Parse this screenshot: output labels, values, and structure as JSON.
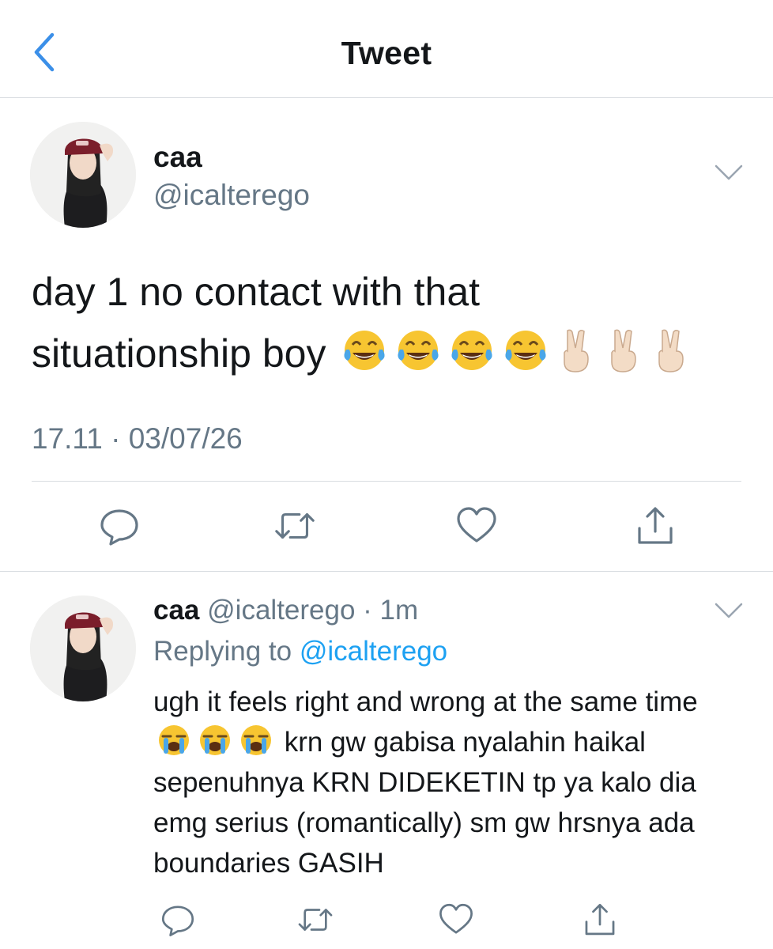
{
  "header": {
    "title": "Tweet"
  },
  "main_tweet": {
    "display_name": "caa",
    "handle": "@icalterego",
    "text_line1": "day 1 no contact with that",
    "text_line2": "situationship boy",
    "emojis": [
      "😂",
      "😂",
      "😂",
      "😂",
      "✌️",
      "✌️",
      "✌️"
    ],
    "timestamp": "17.11 · 03/07/26"
  },
  "reply": {
    "display_name": "caa",
    "handle": "@icalterego",
    "time": "· 1m",
    "replying_to_label": "Replying to",
    "replying_to_handle": "@icalterego",
    "text_part1": "ugh it feels right and wrong at the same time",
    "emojis": [
      "😭",
      "😭",
      "😭"
    ],
    "text_part2": "krn gw gabisa nyalahin haikal sepenuhnya KRN DIDEKETIN tp ya kalo dia emg serius (romantically) sm gw hrsnya ada boundaries GASIH"
  },
  "icons": {
    "back": "chevron-left-icon",
    "more": "chevron-down-icon",
    "reply": "reply-icon",
    "retweet": "retweet-icon",
    "like": "heart-icon",
    "share": "share-icon"
  },
  "colors": {
    "accent": "#1da1f2",
    "secondary_text": "#657786",
    "divider": "#d9dde1",
    "back_arrow": "#3b8fe8"
  }
}
